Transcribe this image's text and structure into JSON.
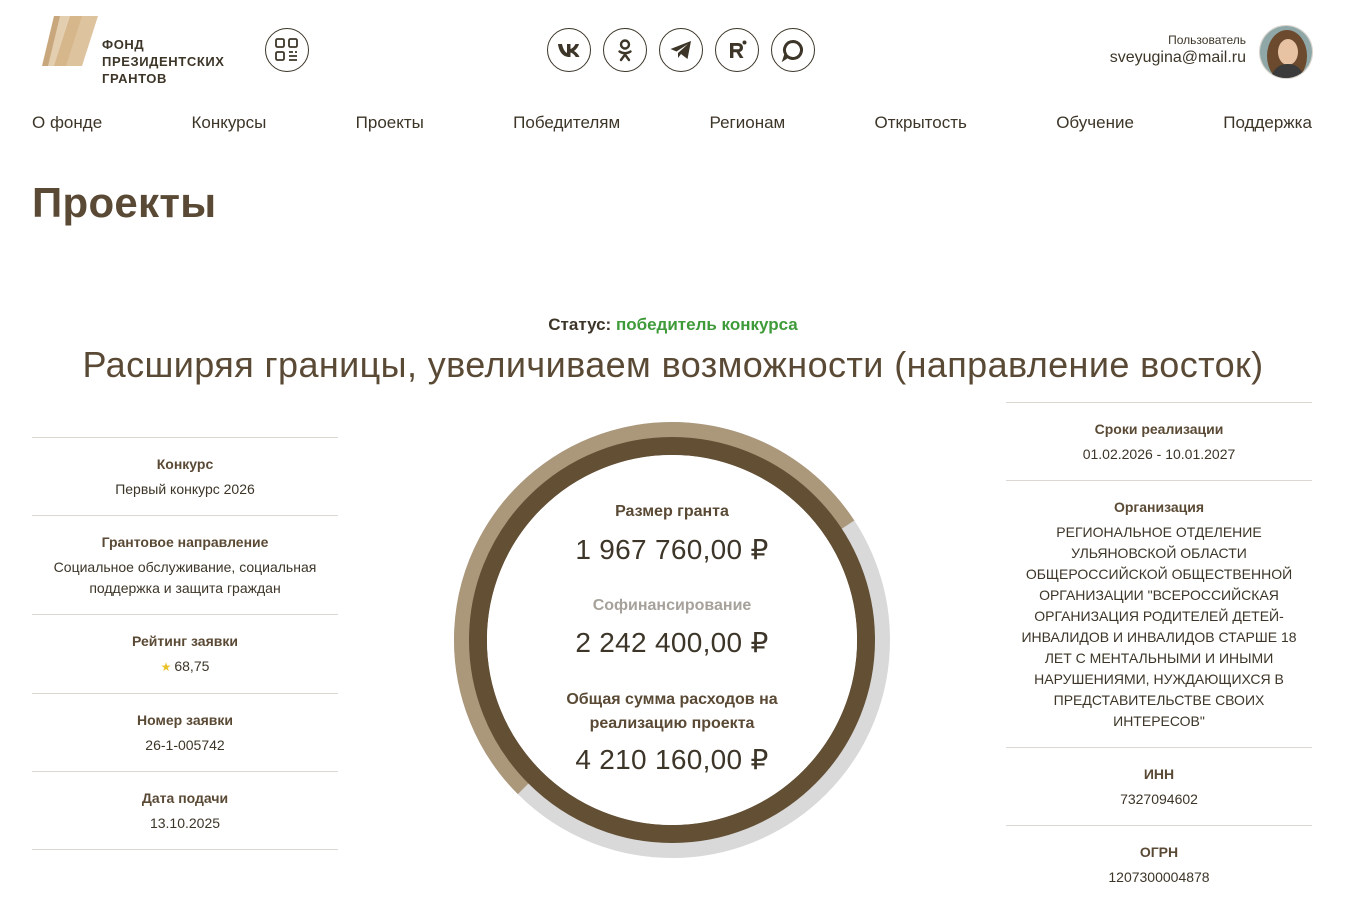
{
  "header": {
    "logo_lines": [
      "ФОНД",
      "ПРЕЗИДЕНТСКИХ",
      "ГРАНТОВ"
    ],
    "user_label": "Пользователь",
    "user_email": "sveyugina@mail.ru",
    "icons": {
      "qr": "qr-code-icon",
      "socials": [
        "vk-icon",
        "odnoklassniki-icon",
        "telegram-icon",
        "rutube-icon",
        "max-messenger-icon"
      ]
    }
  },
  "nav": [
    "О фонде",
    "Конкурсы",
    "Проекты",
    "Победителям",
    "Регионам",
    "Открытость",
    "Обучение",
    "Поддержка"
  ],
  "page_title": "Проекты",
  "project": {
    "status_label": "Статус:",
    "status_value": "победитель конкурса",
    "title": "Расширяя границы, увеличиваем возможности (направление восток)"
  },
  "left_info": [
    {
      "label": "Конкурс",
      "value": "Первый конкурс 2026"
    },
    {
      "label": "Грантовое направление",
      "value": "Социальное обслуживание, социальная поддержка и защита граждан"
    },
    {
      "label": "Рейтинг заявки",
      "value": "68,75"
    },
    {
      "label": "Номер заявки",
      "value": "26-1-005742"
    },
    {
      "label": "Дата подачи",
      "value": "13.10.2025"
    }
  ],
  "right_info": [
    {
      "label": "Сроки реализации",
      "value": "01.02.2026 - 10.01.2027"
    },
    {
      "label": "Организация",
      "value": "РЕГИОНАЛЬНОЕ ОТДЕЛЕНИЕ УЛЬЯНОВСКОЙ ОБЛАСТИ ОБЩЕРОССИЙСКОЙ ОБЩЕСТВЕННОЙ ОРГАНИЗАЦИИ \"ВСЕРОССИЙСКАЯ ОРГАНИЗАЦИЯ РОДИТЕЛЕЙ ДЕТЕЙ-ИНВАЛИДОВ И ИНВАЛИДОВ СТАРШЕ 18 ЛЕТ С МЕНТАЛЬНЫМИ И ИНЫМИ НАРУШЕНИЯМИ, НУЖДАЮЩИХСЯ В ПРЕДСТАВИТЕЛЬСТВЕ СВОИХ ИНТЕРЕСОВ\""
    },
    {
      "label": "ИНН",
      "value": "7327094602"
    },
    {
      "label": "ОГРН",
      "value": "1207300004878"
    }
  ],
  "funding": {
    "grant_label": "Размер гранта",
    "grant_value": "1 967 760,00 ₽",
    "cofinancing_label": "Софинансирование",
    "cofinancing_value": "2 242 400,00 ₽",
    "total_label": "Общая сумма расходов на реализацию проекта",
    "total_value": "4 210 160,00 ₽",
    "grant_amount": 1967760,
    "cofinancing_amount": 2242400,
    "total_amount": 4210160,
    "colors": {
      "grant": "#624f34",
      "cofinancing": "#ab977a",
      "rest": "#d9d9d9"
    }
  }
}
